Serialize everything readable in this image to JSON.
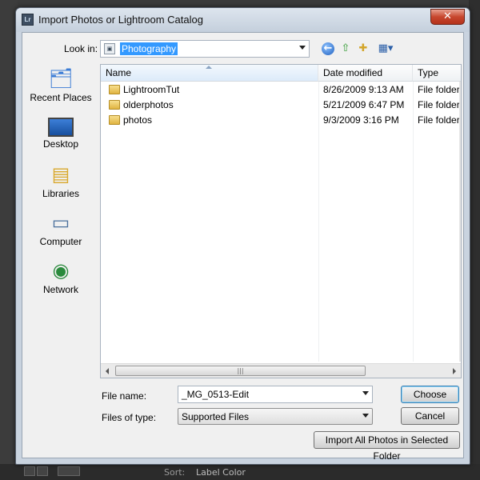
{
  "window": {
    "app_icon": "Lr",
    "title": "Import Photos or Lightroom Catalog",
    "close_glyph": "✕"
  },
  "toolbar": {
    "lookin_label": "Look in:",
    "lookin_value": "Photography",
    "lookin_icon": "folder-icon",
    "back_icon": "back-arrow-icon",
    "up_icon": "up-folder-icon",
    "newfolder_icon": "new-folder-icon",
    "views_icon": "views-menu-icon"
  },
  "places": [
    {
      "label": "Recent Places",
      "icon": "recent-places-icon"
    },
    {
      "label": "Desktop",
      "icon": "desktop-icon"
    },
    {
      "label": "Libraries",
      "icon": "libraries-icon"
    },
    {
      "label": "Computer",
      "icon": "computer-icon"
    },
    {
      "label": "Network",
      "icon": "network-icon"
    }
  ],
  "filelist": {
    "columns": {
      "name": "Name",
      "date": "Date modified",
      "type": "Type"
    },
    "rows": [
      {
        "name": "LightroomTut",
        "date": "8/26/2009 9:13 AM",
        "type": "File folder"
      },
      {
        "name": "olderphotos",
        "date": "5/21/2009 6:47 PM",
        "type": "File folder"
      },
      {
        "name": "photos",
        "date": "9/3/2009 3:16 PM",
        "type": "File folder"
      }
    ]
  },
  "form": {
    "filename_label": "File name:",
    "filename_value": "_MG_0513-Edit",
    "filetype_label": "Files of type:",
    "filetype_value": "Supported Files"
  },
  "buttons": {
    "choose": "Choose",
    "cancel": "Cancel",
    "import_all": "Import All Photos in Selected Folder"
  },
  "background": {
    "sort_label": "Sort:",
    "sort_value": "Label Color"
  }
}
